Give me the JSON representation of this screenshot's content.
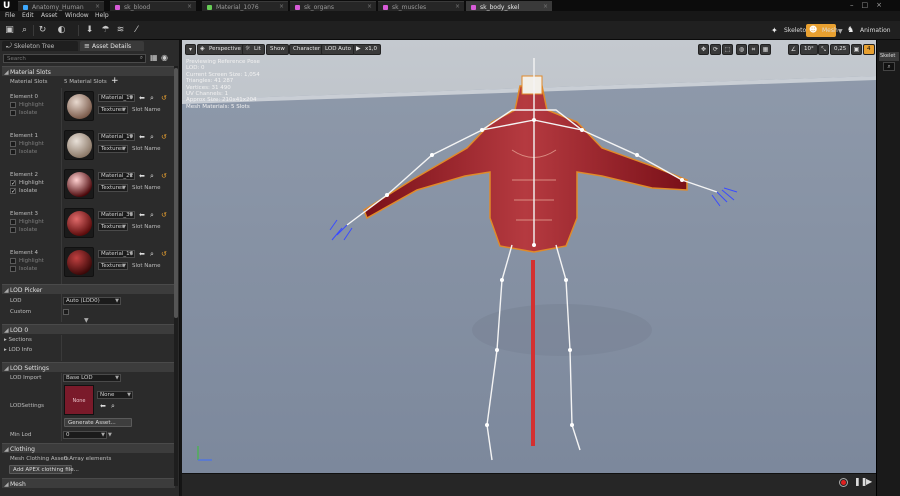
{
  "doc_tabs": [
    {
      "label": "Anatomy_Human",
      "color": "#3da9ff"
    },
    {
      "label": "sk_blood",
      "color": "#d85bd8"
    },
    {
      "label": "Material_1076",
      "color": "#66cc55"
    },
    {
      "label": "sk_organs",
      "color": "#d85bd8"
    },
    {
      "label": "sk_muscles",
      "color": "#d85bd8"
    },
    {
      "label": "sk_body_skel",
      "color": "#d85bd8"
    }
  ],
  "menu": [
    "File",
    "Edit",
    "Asset",
    "Window",
    "Help"
  ],
  "modes": {
    "skeleton": "Skeleton",
    "mesh": "Mesh",
    "animation": "Animation"
  },
  "panel_tabs": {
    "skeleton_tree": "Skeleton Tree",
    "asset_details": "Asset Details"
  },
  "search": {
    "placeholder": "Search"
  },
  "material_slots": {
    "header": "Material Slots",
    "label": "Material Slots",
    "count": "5 Material Slots",
    "elements": [
      {
        "name": "Element 0",
        "material": "Material_19",
        "textures": "Textures",
        "slot": "Slot Name",
        "highlight": "Highlight",
        "isolate": "Isolate",
        "highlight_on": false,
        "isolate_on": false,
        "c1": "#e8d9cf",
        "c2": "#7a5a4a"
      },
      {
        "name": "Element 1",
        "material": "Material_19",
        "textures": "Textures",
        "slot": "Slot Name",
        "highlight": "Highlight",
        "isolate": "Isolate",
        "highlight_on": false,
        "isolate_on": false,
        "c1": "#e8e0d8",
        "c2": "#8a7766"
      },
      {
        "name": "Element 2",
        "material": "Material_22",
        "textures": "Textures",
        "slot": "Slot Name",
        "highlight": "Highlight",
        "isolate": "Isolate",
        "highlight_on": true,
        "isolate_on": true,
        "c1": "#ffd0d0",
        "c2": "#4a0508"
      },
      {
        "name": "Element 3",
        "material": "Material_33",
        "textures": "Textures",
        "slot": "Slot Name",
        "highlight": "Highlight",
        "isolate": "Isolate",
        "highlight_on": false,
        "isolate_on": false,
        "c1": "#e06a6a",
        "c2": "#5a0a0a"
      },
      {
        "name": "Element 4",
        "material": "Material_16",
        "textures": "Textures",
        "slot": "Slot Name",
        "highlight": "Highlight",
        "isolate": "Isolate",
        "highlight_on": false,
        "isolate_on": false,
        "c1": "#c04040",
        "c2": "#3a0808"
      }
    ]
  },
  "lod_picker": {
    "header": "LOD Picker",
    "lod_label": "LOD",
    "lod_value": "Auto (LOD0)",
    "custom_label": "Custom"
  },
  "lod0": {
    "header": "LOD 0",
    "sections": "Sections",
    "lod_info": "LOD Info"
  },
  "lod_settings": {
    "header": "LOD Settings",
    "import_label": "LOD Import",
    "import_value": "Base LOD",
    "settings_label": "LODSettings",
    "thumb_label": "None",
    "none_value": "None",
    "generate": "Generate Asset...",
    "min_lod_label": "Min Lod",
    "min_lod_value": "0"
  },
  "clothing": {
    "header": "Clothing",
    "mesh_assets_label": "Mesh Clothing Assets",
    "mesh_assets_value": "0 Array elements",
    "add_button": "Add APEX clothing file..."
  },
  "mesh": {
    "header": "Mesh"
  },
  "viewport": {
    "perspective": "Perspective",
    "lit": "Lit",
    "show": "Show",
    "character": "Character",
    "lod_auto": "LOD Auto",
    "speed": "x1,0",
    "snap_angle": "10°",
    "scale": "0,25",
    "camera_speed": "4"
  },
  "stats": [
    "Previewing Reference Pose",
    "LOD: 0",
    "Current Screen Size: 1,054",
    "Triangles: 41 287",
    "Vertices: 31 490",
    "UV Channels: 1",
    "Approx Size: 210x41x204",
    "Mesh Materials: 5 Slots"
  ],
  "right_strip": {
    "tab": "Skelet"
  }
}
